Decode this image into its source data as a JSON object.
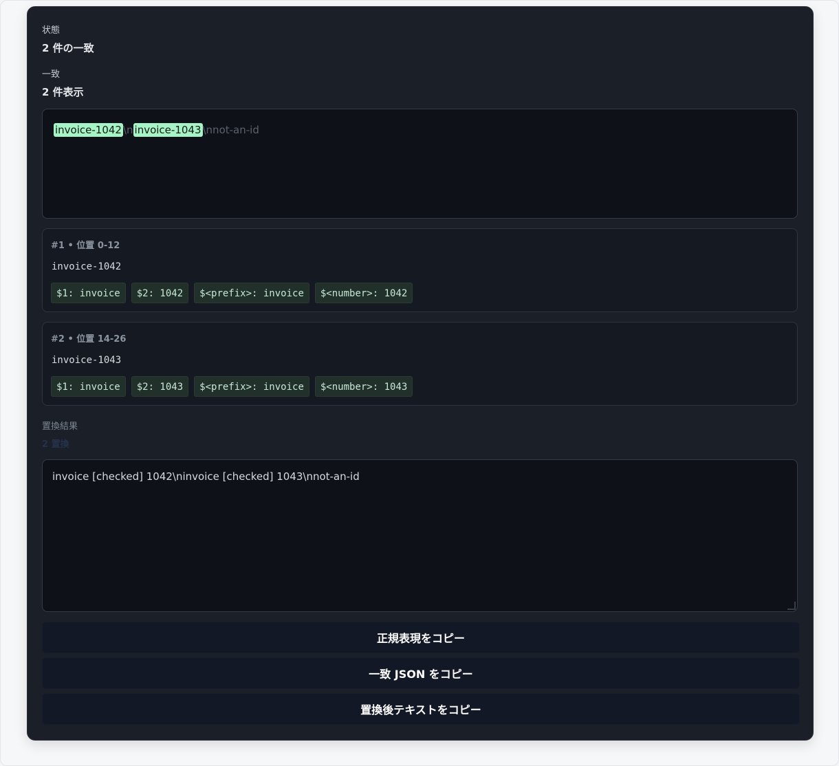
{
  "status": {
    "label": "状態",
    "value": "2 件の一致"
  },
  "matches_summary": {
    "label": "一致",
    "value": "2 件表示"
  },
  "preview": {
    "match1": "invoice-1042",
    "sep1": "\\n",
    "match2": "invoice-1043",
    "rest": "\\nnot-an-id"
  },
  "matches": [
    {
      "header": "#1 • 位置 0-12",
      "text": "invoice-1042",
      "groups": [
        "$1: invoice",
        "$2: 1042",
        "$<prefix>: invoice",
        "$<number>: 1042"
      ]
    },
    {
      "header": "#2 • 位置 14-26",
      "text": "invoice-1043",
      "groups": [
        "$1: invoice",
        "$2: 1043",
        "$<prefix>: invoice",
        "$<number>: 1043"
      ]
    }
  ],
  "replace": {
    "label": "置換結果",
    "sublabel": "2 置換",
    "output": "invoice [checked] 1042\\ninvoice [checked] 1043\\nnot-an-id"
  },
  "buttons": {
    "copy_regex": "正規表現をコピー",
    "copy_json": "一致 JSON をコピー",
    "copy_replaced": "置換後テキストをコピー"
  },
  "colors": {
    "panel_bg": "#1a1f28",
    "highlight": "#a6f3c6",
    "chip_bg": "#22302b"
  }
}
